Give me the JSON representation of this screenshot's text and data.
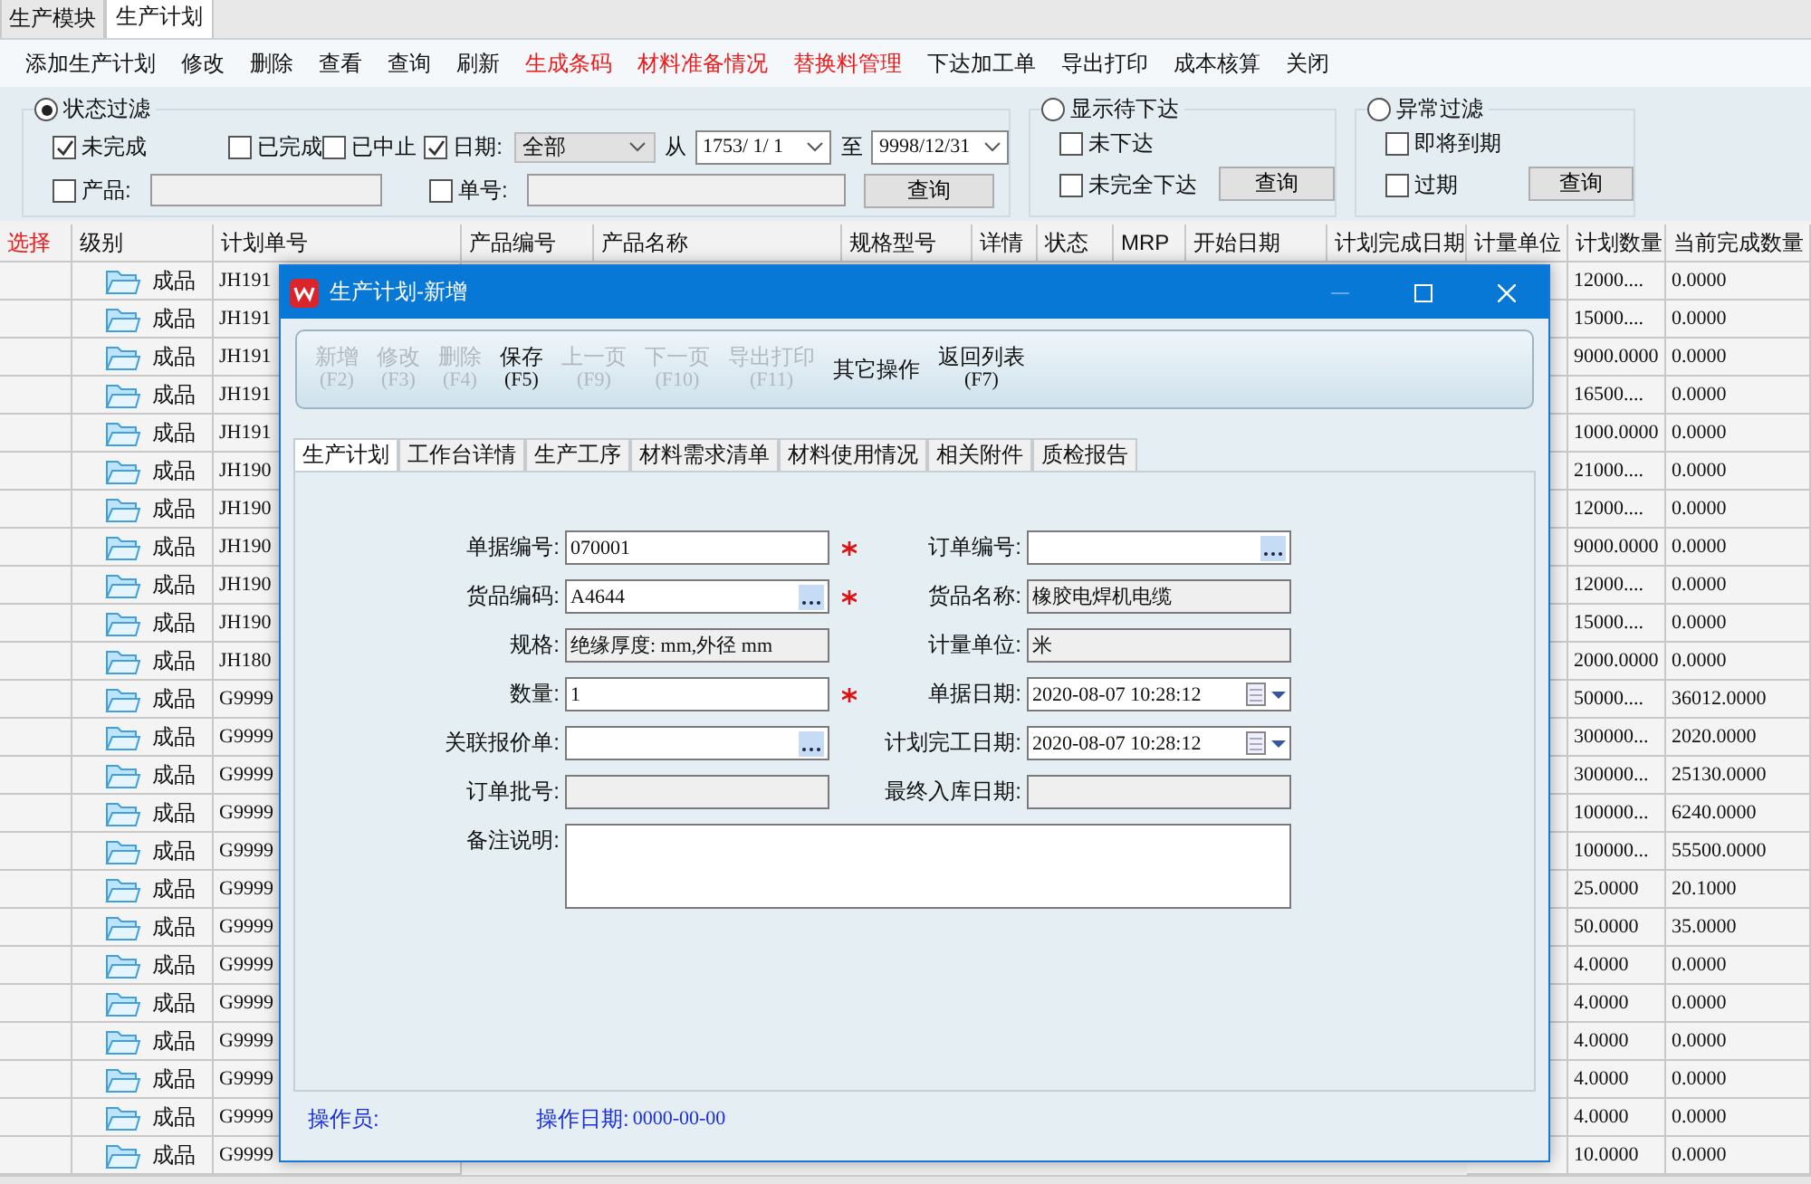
{
  "module_tabs": [
    {
      "label": "生产模块",
      "selected": false
    },
    {
      "label": "生产计划",
      "selected": true
    }
  ],
  "toolbar": [
    {
      "label": "添加生产计划",
      "highlight": false
    },
    {
      "label": "修改",
      "highlight": false
    },
    {
      "label": "删除",
      "highlight": false
    },
    {
      "label": "查看",
      "highlight": false
    },
    {
      "label": "查询",
      "highlight": false
    },
    {
      "label": "刷新",
      "highlight": false
    },
    {
      "label": "生成条码",
      "highlight": true
    },
    {
      "label": "材料准备情况",
      "highlight": true
    },
    {
      "label": "替换料管理",
      "highlight": true
    },
    {
      "label": "下达加工单",
      "highlight": false
    },
    {
      "label": "导出打印",
      "highlight": false
    },
    {
      "label": "成本核算",
      "highlight": false
    },
    {
      "label": "关闭",
      "highlight": false
    }
  ],
  "status_filter": {
    "label": "状态过滤",
    "selected": true,
    "checks": [
      {
        "label": "未完成",
        "checked": true
      },
      {
        "label": "已完成",
        "checked": false
      },
      {
        "label": "已中止",
        "checked": false
      }
    ],
    "date": {
      "label": "日期:",
      "checked": true,
      "range": "全部",
      "from_label": "从",
      "from": "1753/ 1/ 1",
      "to_label": "至",
      "to": "9998/12/31"
    },
    "product": {
      "label": "产品:",
      "checked": false
    },
    "order_no": {
      "label": "单号:",
      "checked": false
    },
    "query": "查询"
  },
  "pending_filter": {
    "label": "显示待下达",
    "selected": false,
    "checks": [
      {
        "label": "未下达",
        "checked": false
      },
      {
        "label": "未完全下达",
        "checked": false
      }
    ],
    "query": "查询"
  },
  "abnormal_filter": {
    "label": "异常过滤",
    "selected": false,
    "checks": [
      {
        "label": "即将到期",
        "checked": false
      },
      {
        "label": "过期",
        "checked": false
      }
    ],
    "query": "查询"
  },
  "table": {
    "columns": [
      {
        "label": "选择",
        "highlight": true
      },
      {
        "label": "级别",
        "highlight": false
      },
      {
        "label": "计划单号",
        "highlight": false
      },
      {
        "label": "产品编号",
        "highlight": false
      },
      {
        "label": "产品名称",
        "highlight": false
      },
      {
        "label": "规格型号",
        "highlight": false
      },
      {
        "label": "详情",
        "highlight": false
      },
      {
        "label": "状态",
        "highlight": false
      },
      {
        "label": "MRP",
        "highlight": false
      },
      {
        "label": "开始日期",
        "highlight": false
      },
      {
        "label": "计划完成日期",
        "highlight": false
      },
      {
        "label": "计量单位",
        "highlight": false
      },
      {
        "label": "计划数量",
        "highlight": false
      },
      {
        "label": "当前完成数量",
        "highlight": false
      }
    ],
    "rows": [
      {
        "level": "成品",
        "plan_no": "JH191",
        "plan_qty": "12000....",
        "done_qty": "0.0000"
      },
      {
        "level": "成品",
        "plan_no": "JH191",
        "plan_qty": "15000....",
        "done_qty": "0.0000"
      },
      {
        "level": "成品",
        "plan_no": "JH191",
        "plan_qty": "9000.0000",
        "done_qty": "0.0000"
      },
      {
        "level": "成品",
        "plan_no": "JH191",
        "plan_qty": "16500....",
        "done_qty": "0.0000"
      },
      {
        "level": "成品",
        "plan_no": "JH191",
        "plan_qty": "1000.0000",
        "done_qty": "0.0000"
      },
      {
        "level": "成品",
        "plan_no": "JH190",
        "plan_qty": "21000....",
        "done_qty": "0.0000"
      },
      {
        "level": "成品",
        "plan_no": "JH190",
        "plan_qty": "12000....",
        "done_qty": "0.0000"
      },
      {
        "level": "成品",
        "plan_no": "JH190",
        "plan_qty": "9000.0000",
        "done_qty": "0.0000"
      },
      {
        "level": "成品",
        "plan_no": "JH190",
        "plan_qty": "12000....",
        "done_qty": "0.0000"
      },
      {
        "level": "成品",
        "plan_no": "JH190",
        "plan_qty": "15000....",
        "done_qty": "0.0000"
      },
      {
        "level": "成品",
        "plan_no": "JH180",
        "plan_qty": "2000.0000",
        "done_qty": "0.0000"
      },
      {
        "level": "成品",
        "plan_no": "G9999",
        "plan_qty": "50000....",
        "done_qty": "36012.0000"
      },
      {
        "level": "成品",
        "plan_no": "G9999",
        "plan_qty": "300000...",
        "done_qty": "2020.0000"
      },
      {
        "level": "成品",
        "plan_no": "G9999",
        "plan_qty": "300000...",
        "done_qty": "25130.0000"
      },
      {
        "level": "成品",
        "plan_no": "G9999",
        "plan_qty": "100000...",
        "done_qty": "6240.0000"
      },
      {
        "level": "成品",
        "plan_no": "G9999",
        "plan_qty": "100000...",
        "done_qty": "55500.0000"
      },
      {
        "level": "成品",
        "plan_no": "G9999",
        "plan_qty": "25.0000",
        "done_qty": "20.1000"
      },
      {
        "level": "成品",
        "plan_no": "G9999",
        "plan_qty": "50.0000",
        "done_qty": "35.0000"
      },
      {
        "level": "成品",
        "plan_no": "G9999",
        "plan_qty": "4.0000",
        "done_qty": "0.0000"
      },
      {
        "level": "成品",
        "plan_no": "G9999",
        "plan_qty": "4.0000",
        "done_qty": "0.0000"
      },
      {
        "level": "成品",
        "plan_no": "G9999",
        "plan_qty": "4.0000",
        "done_qty": "0.0000"
      },
      {
        "level": "成品",
        "plan_no": "G9999",
        "plan_qty": "4.0000",
        "done_qty": "0.0000"
      },
      {
        "level": "成品",
        "plan_no": "G9999",
        "plan_qty": "4.0000",
        "done_qty": "0.0000"
      },
      {
        "level": "成品",
        "plan_no": "G9999",
        "plan_qty": "10.0000",
        "done_qty": "0.0000"
      }
    ]
  },
  "dialog": {
    "title": "生产计划-新增",
    "toolbar": [
      {
        "label": "新增",
        "key": "(F2)",
        "enabled": false
      },
      {
        "label": "修改",
        "key": "(F3)",
        "enabled": false
      },
      {
        "label": "删除",
        "key": "(F4)",
        "enabled": false
      },
      {
        "label": "保存",
        "key": "(F5)",
        "enabled": true
      },
      {
        "label": "上一页",
        "key": "(F9)",
        "enabled": false
      },
      {
        "label": "下一页",
        "key": "(F10)",
        "enabled": false
      },
      {
        "label": "导出打印",
        "key": "(F11)",
        "enabled": false
      },
      {
        "label": "其它操作",
        "enabled": true
      },
      {
        "label": "返回列表",
        "key": "(F7)",
        "enabled": true
      }
    ],
    "tabs": [
      {
        "label": "生产计划",
        "selected": true
      },
      {
        "label": "工作台详情",
        "selected": false
      },
      {
        "label": "生产工序",
        "selected": false
      },
      {
        "label": "材料需求清单",
        "selected": false
      },
      {
        "label": "材料使用情况",
        "selected": false
      },
      {
        "label": "相关附件",
        "selected": false
      },
      {
        "label": "质检报告",
        "selected": false
      }
    ],
    "form_rows": [
      {
        "left": {
          "label": "单据编号:",
          "value": "070001",
          "kind": "text",
          "required": true
        },
        "right": {
          "label": "订单编号:",
          "kind": "lookup",
          "required": false
        }
      },
      {
        "left": {
          "label": "货品编码:",
          "value": "A4644",
          "kind": "lookup",
          "required": true
        },
        "right": {
          "label": "货品名称:",
          "value": "橡胶电焊机电缆",
          "kind": "readonly",
          "required": false
        }
      },
      {
        "left": {
          "label": "规格:",
          "value": "绝缘厚度: mm,外径 mm",
          "kind": "readonly",
          "required": false
        },
        "right": {
          "label": "计量单位:",
          "value": "米",
          "kind": "readonly",
          "required": false
        }
      },
      {
        "left": {
          "label": "数量:",
          "value": "1",
          "kind": "text",
          "required": true
        },
        "right": {
          "label": "单据日期:",
          "value": "2020-08-07 10:28:12",
          "kind": "date",
          "required": false
        }
      },
      {
        "left": {
          "label": "关联报价单:",
          "kind": "lookup",
          "required": false
        },
        "right": {
          "label": "计划完工日期:",
          "value": "2020-08-07 10:28:12",
          "kind": "date",
          "required": false
        }
      },
      {
        "left": {
          "label": "订单批号:",
          "kind": "readonly",
          "required": false
        },
        "right": {
          "label": "最终入库日期:",
          "kind": "readonly",
          "required": false
        }
      }
    ],
    "memo": {
      "label": "备注说明:"
    },
    "footer": {
      "operator_label": "操作员:",
      "date_label": "操作日期:",
      "date": "0000-00-00"
    }
  }
}
